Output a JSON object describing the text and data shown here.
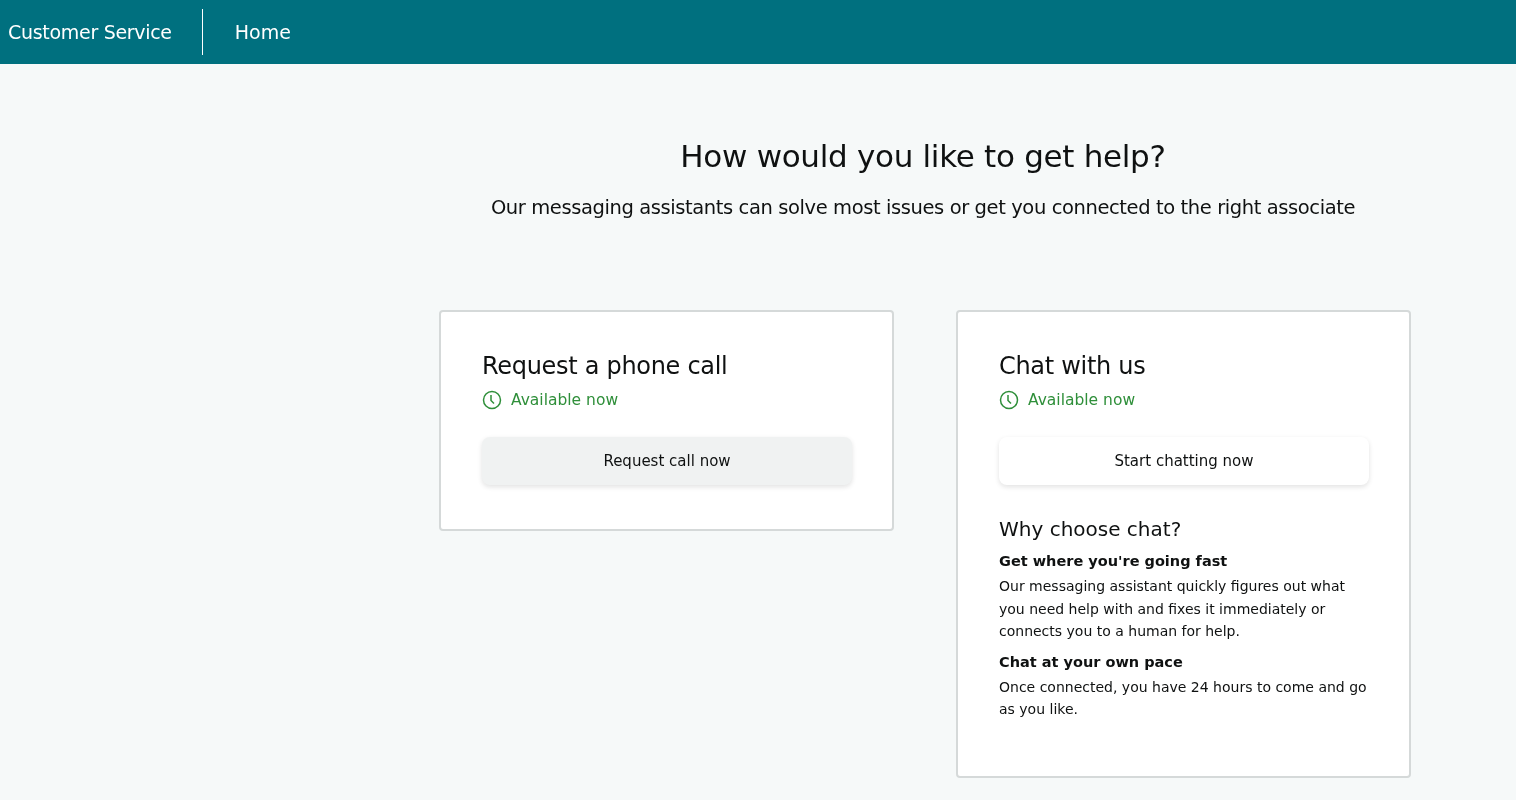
{
  "header": {
    "title": "Customer Service",
    "nav": [
      {
        "label": "Home"
      }
    ]
  },
  "heading": "How would you like to get help?",
  "subtitle": "Our messaging assistants can solve most issues or get you connected to the right associate",
  "cards": [
    {
      "title": "Request a phone call",
      "status": "Available now",
      "button": {
        "label": "Request call now",
        "hovered": true
      }
    },
    {
      "title": "Chat with us",
      "status": "Available now",
      "button": {
        "label": "Start chatting now",
        "hovered": false
      },
      "info": {
        "title": "Why choose chat?",
        "points": [
          {
            "title": "Get where you're going fast",
            "text": "Our messaging assistant quickly figures out what you need help with and fixes it immediately or connects you to a human for help."
          },
          {
            "title": "Chat at your own pace",
            "text": "Once connected, you have 24 hours to come and go as you like."
          }
        ]
      }
    }
  ]
}
